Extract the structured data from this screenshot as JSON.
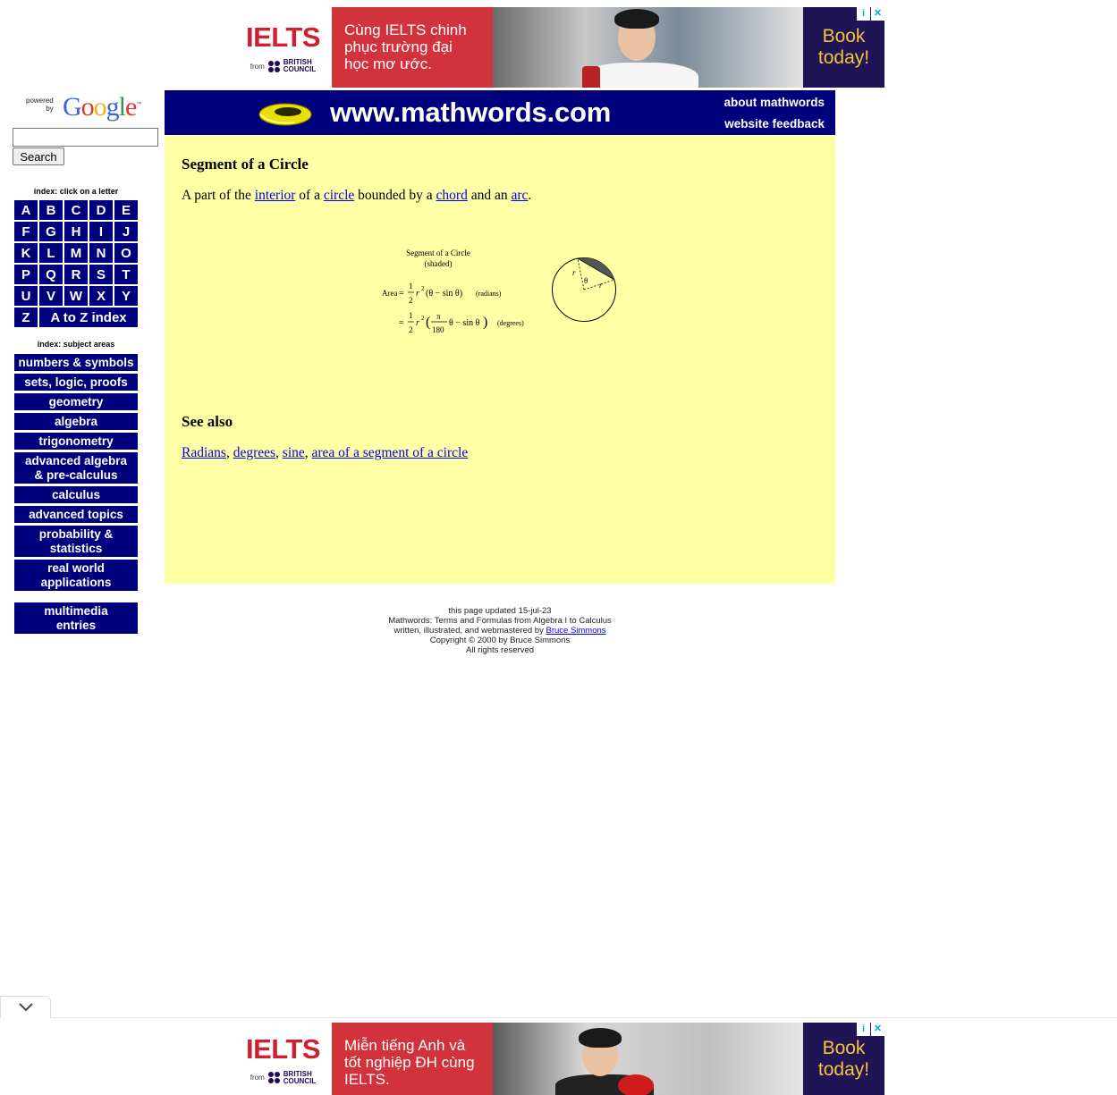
{
  "top_ad": {
    "brand": "IELTS",
    "from_label": "from",
    "partner": [
      "BRITISH",
      "COUNCIL"
    ],
    "headline": "Cùng IELTS chinh phục trường đại học mơ ước.",
    "cta": "Book today!",
    "info_icon": "info-icon",
    "close_icon": "close-icon"
  },
  "bottom_ad": {
    "brand": "IELTS",
    "from_label": "from",
    "partner": [
      "BRITISH",
      "COUNCIL"
    ],
    "headline": "Miễn tiếng Anh và tốt nghiệp ĐH cùng IELTS.",
    "cta": "Book today!",
    "info_icon": "info-icon",
    "close_icon": "close-icon"
  },
  "search": {
    "powered": "powered",
    "by": "by",
    "logo": [
      "G",
      "o",
      "o",
      "g",
      "l",
      "e"
    ],
    "tm": "™",
    "input_value": "",
    "button_label": "Search"
  },
  "sidebar": {
    "letter_index_title": "index: click on a letter",
    "letters": [
      "A",
      "B",
      "C",
      "D",
      "E",
      "F",
      "G",
      "H",
      "I",
      "J",
      "K",
      "L",
      "M",
      "N",
      "O",
      "P",
      "Q",
      "R",
      "S",
      "T",
      "U",
      "V",
      "W",
      "X",
      "Y",
      "Z"
    ],
    "az_label": "A to Z index",
    "subject_index_title": "index: subject areas",
    "subjects": [
      {
        "label": "numbers & symbols"
      },
      {
        "label": "sets, logic, proofs"
      },
      {
        "label": "geometry"
      },
      {
        "label": "algebra"
      },
      {
        "label": "trigonometry"
      },
      {
        "label": "advanced algebra\n& pre-calculus"
      },
      {
        "label": "calculus"
      },
      {
        "label": "advanced topics"
      },
      {
        "label": "probability &\nstatistics"
      },
      {
        "label": "real world\napplications"
      }
    ],
    "multimedia": "multimedia\nentries"
  },
  "header": {
    "site_url": "www.mathwords.com",
    "about_link": "about mathwords",
    "feedback_link": "website feedback"
  },
  "content": {
    "title": "Segment of a Circle",
    "definition": {
      "t1": "A part of the ",
      "l1": "interior",
      "t2": " of a ",
      "l2": "circle",
      "t3": " bounded by a ",
      "l3": "chord",
      "t4": " and an ",
      "l4": "arc",
      "t5": "."
    },
    "figure": {
      "caption1": "Segment of a Circle",
      "caption2": "(shaded)",
      "area_label": "Area",
      "eq": "=",
      "one": "1",
      "two": "2",
      "r": "r",
      "sup2": "2",
      "expr_radians": "(θ − sin θ)",
      "radians_label": "(radians)",
      "pi": "π",
      "d180": "180",
      "expr_degrees": "θ − sin θ",
      "degrees_label": "(degrees)",
      "theta": "θ"
    },
    "see_also_title": "See also",
    "see_also": {
      "l1": "Radians",
      "l2": "degrees",
      "l3": "sine",
      "l4": "area of a segment of a circle",
      "sep": ", "
    }
  },
  "footer": {
    "updated": "this page updated 15-jul-23",
    "tagline": "Mathwords: Terms and Formulas from Algebra I to Calculus",
    "written_by": "written, illustrated, and webmastered by ",
    "author_link": "Bruce Simmons",
    "copyright": "Copyright © 2000 by Bruce Simmons",
    "rights": "All rights reserved"
  },
  "colors": {
    "nav_blue": "#00007d",
    "content_yellow": "#ffffa6",
    "link": "#0000ee",
    "ielts_red": "#d0202f",
    "cta_yellow": "#f6c33b"
  },
  "collapse_icon": "chevron-down-icon"
}
